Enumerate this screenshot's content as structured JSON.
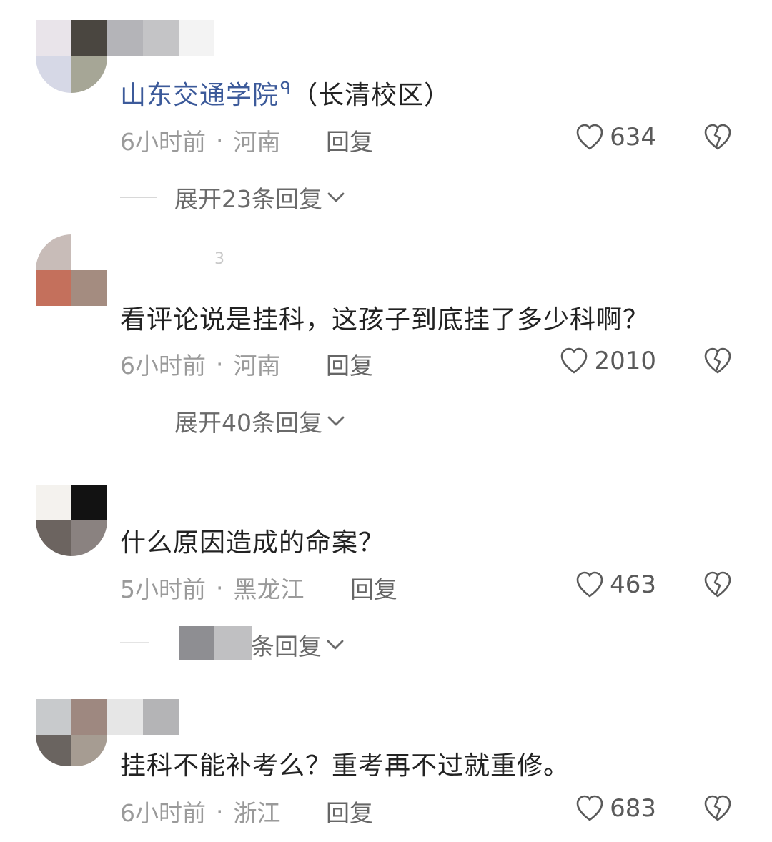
{
  "comments": [
    {
      "username": "山东交通学院",
      "campus": "（长清校区）",
      "text": "",
      "time": "6小时前",
      "region": "河南",
      "reply_label": "回复",
      "likes": "634",
      "expand_label": "展开23条回复"
    },
    {
      "username": "3",
      "text": "看评论说是挂科，这孩子到底挂了多少科啊？",
      "time": "6小时前",
      "region": "河南",
      "reply_label": "回复",
      "likes": "2010",
      "expand_label": "展开40条回复"
    },
    {
      "username": "",
      "text": "什么原因造成的命案？",
      "time": "5小时前",
      "region": "黑龙江",
      "reply_label": "回复",
      "likes": "463",
      "expand_label": "0条回复"
    },
    {
      "username": "",
      "text": "挂科不能补考么？重考再不过就重修。",
      "time": "6小时前",
      "region": "浙江",
      "reply_label": "回复",
      "likes": "683"
    }
  ],
  "separator": "·",
  "search_glyph": "ᑫ",
  "icons": {
    "like": "heart-outline-icon",
    "dislike": "broken-heart-icon",
    "expand": "chevron-down-icon"
  },
  "colors": {
    "username": "#3c5a9a",
    "meta": "#9a9a9a",
    "text": "#222222"
  }
}
